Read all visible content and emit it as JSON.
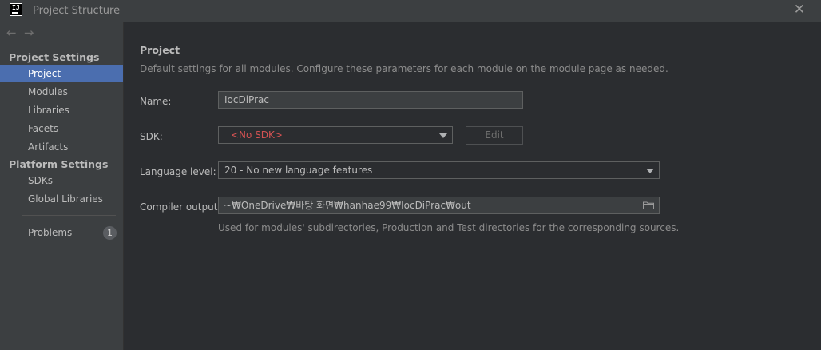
{
  "window": {
    "title": "Project Structure",
    "app_icon_text": "IJ"
  },
  "nav": {
    "back_label": "←",
    "forward_label": "→"
  },
  "sidebar": {
    "project_settings_title": "Project Settings",
    "project_settings_items": [
      {
        "label": "Project",
        "selected": true
      },
      {
        "label": "Modules"
      },
      {
        "label": "Libraries"
      },
      {
        "label": "Facets"
      },
      {
        "label": "Artifacts"
      }
    ],
    "platform_settings_title": "Platform Settings",
    "platform_settings_items": [
      {
        "label": "SDKs"
      },
      {
        "label": "Global Libraries"
      }
    ],
    "problems": {
      "label": "Problems",
      "count": "1"
    }
  },
  "main": {
    "title": "Project",
    "description": "Default settings for all modules. Configure these parameters for each module on the module page as needed.",
    "name": {
      "label": "Name:",
      "value": "IocDiPrac"
    },
    "sdk": {
      "label": "SDK:",
      "value": "<No SDK>",
      "edit_label": "Edit"
    },
    "language_level": {
      "label": "Language level:",
      "value": "20 - No new language features"
    },
    "compiler_output": {
      "label": "Compiler output:",
      "value": "~₩OneDrive₩바탕 화면₩hanhae99₩IocDiPrac₩out",
      "hint": "Used for modules' subdirectories, Production and Test directories for the corresponding sources."
    }
  },
  "colors": {
    "selection": "#4b6eaf",
    "error_text": "#d25252",
    "background": "#2b2d30",
    "panel": "#3c3f41"
  }
}
